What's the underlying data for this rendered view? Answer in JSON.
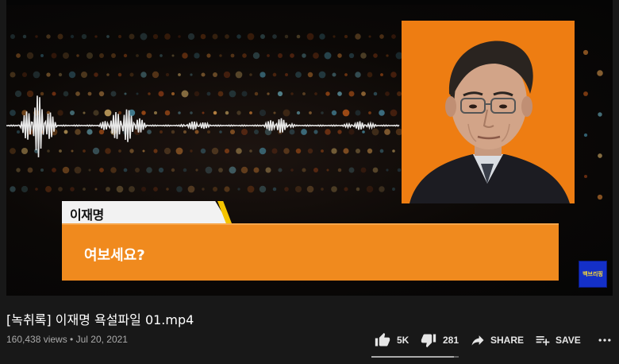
{
  "video": {
    "speaker_name": "이재명",
    "subtitle": "여보세요?",
    "channel_logo_text": "백브리핑",
    "colors": {
      "accent_orange": "#f08a1e",
      "portrait_bg": "#ee7d12",
      "name_tag_accent": "#f5c400"
    }
  },
  "title": "[녹취록] 이재명 욕설파일 01.mp4",
  "meta": {
    "views": "160,438 views",
    "separator": " • ",
    "date": "Jul 20, 2021"
  },
  "actions": {
    "like_count": "5K",
    "dislike_count": "281",
    "share_label": "SHARE",
    "save_label": "SAVE",
    "like_ratio": 0.947
  },
  "icons": {
    "like": "thumbs-up-icon",
    "dislike": "thumbs-down-icon",
    "share": "share-arrow-icon",
    "save": "playlist-add-icon",
    "more": "more-horizontal-icon"
  }
}
